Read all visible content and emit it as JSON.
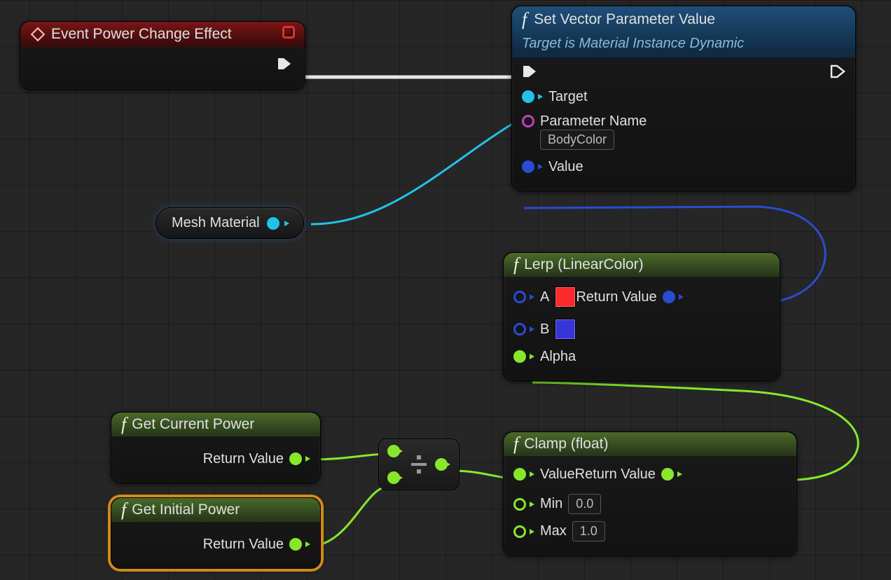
{
  "colors": {
    "exec_white": "#e8e8e8",
    "obj_cyan": "#22c2e8",
    "struct_blue": "#2a4cd0",
    "name_magenta": "#c040c0",
    "float_green": "#87e82a",
    "swatch_a": "#ff2a2a",
    "swatch_b": "#3636d8"
  },
  "event_node": {
    "title": "Event Power Change Effect",
    "exec_out_label": ""
  },
  "set_vec_node": {
    "title": "Set Vector Parameter Value",
    "subtitle": "Target is Material Instance Dynamic",
    "pin_target": "Target",
    "pin_paramname": "Parameter Name",
    "paramname_value": "BodyColor",
    "pin_value": "Value"
  },
  "var_pill": {
    "label": "Mesh Material"
  },
  "lerp_node": {
    "title": "Lerp (LinearColor)",
    "pin_a": "A",
    "pin_b": "B",
    "pin_alpha": "Alpha",
    "pin_return": "Return Value"
  },
  "get_current": {
    "title": "Get Current Power",
    "pin_return": "Return Value"
  },
  "get_initial": {
    "title": "Get Initial Power",
    "pin_return": "Return Value"
  },
  "clamp_node": {
    "title": "Clamp (float)",
    "pin_value": "Value",
    "pin_min": "Min",
    "pin_max": "Max",
    "min_value": "0.0",
    "max_value": "1.0",
    "pin_return": "Return Value"
  }
}
